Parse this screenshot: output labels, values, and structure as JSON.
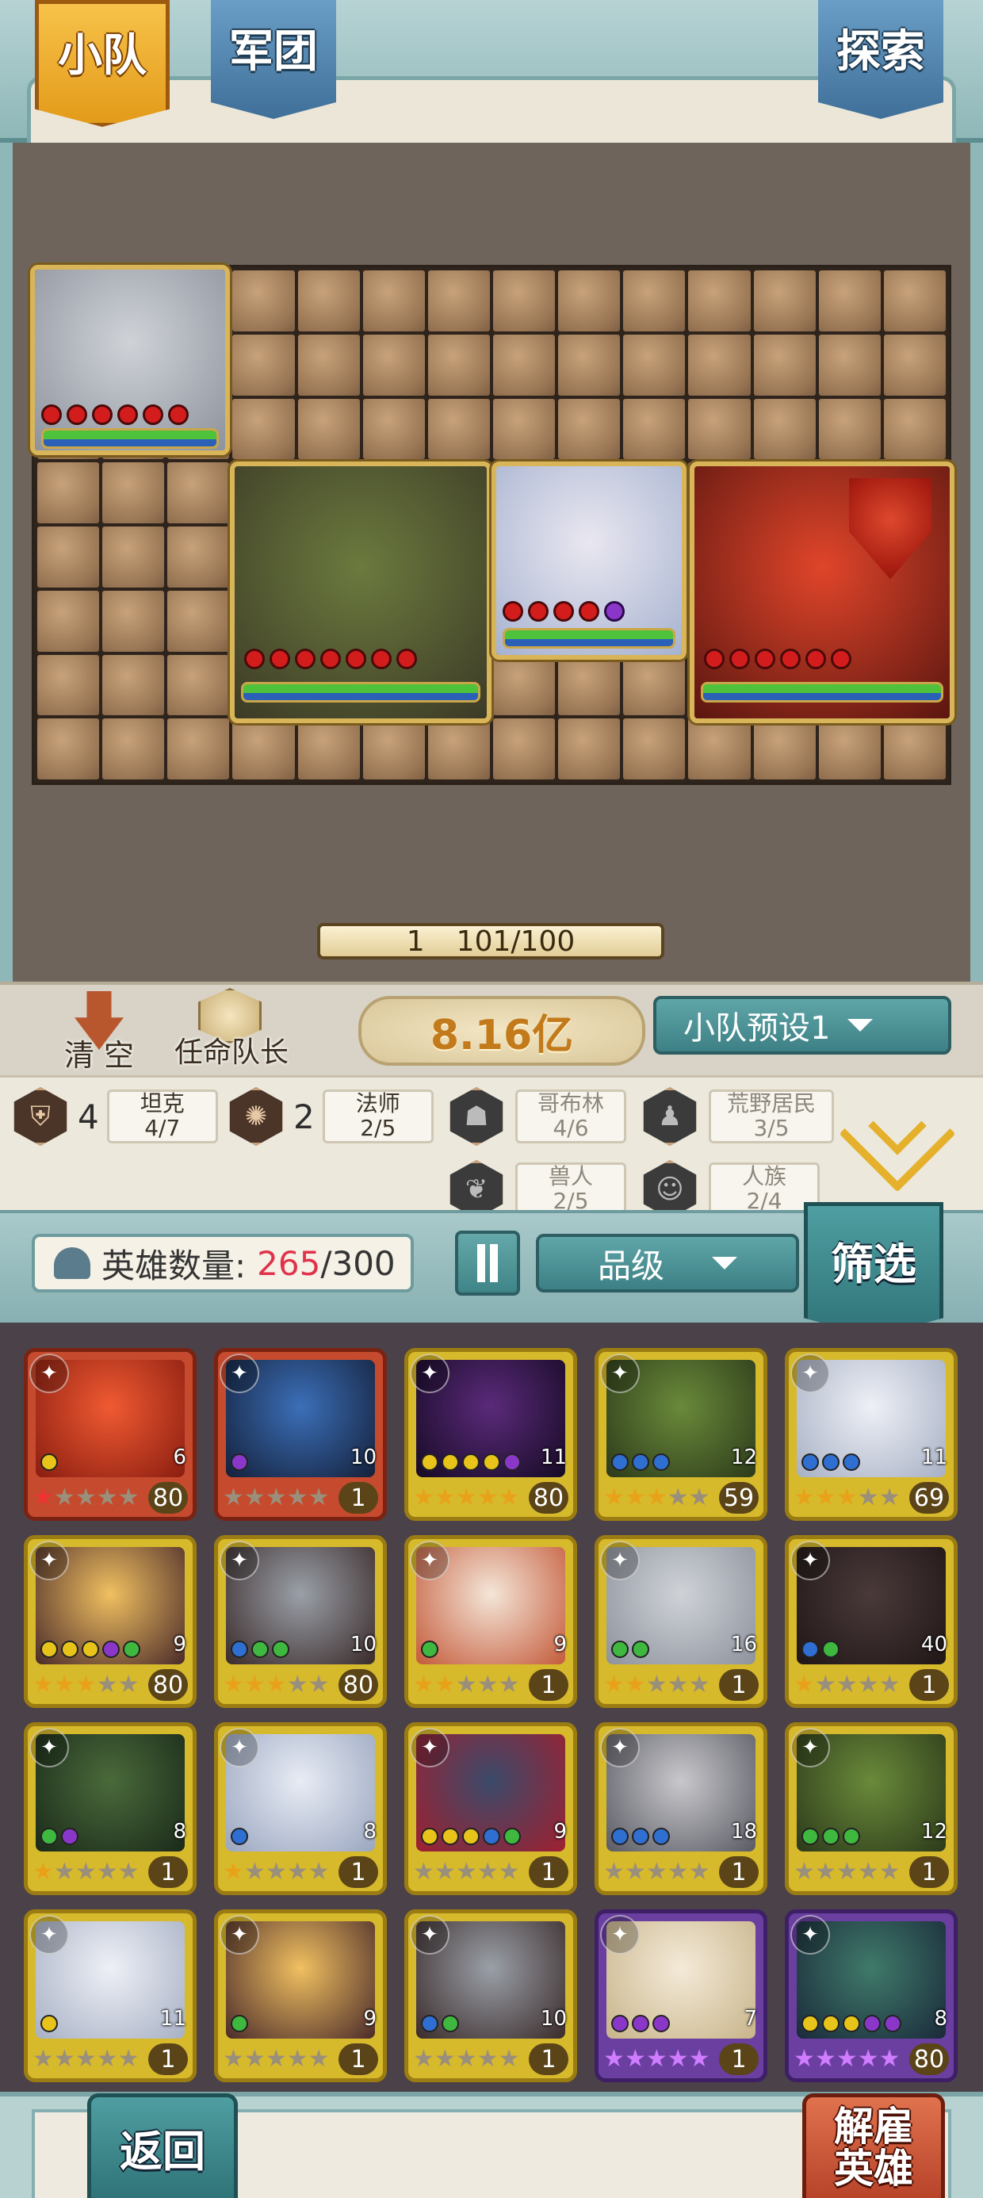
{
  "tabs": {
    "squad": "小队",
    "legion": "军团",
    "explore": "探索"
  },
  "board": {
    "level_bar": {
      "level": "1",
      "progress": "101/100"
    },
    "units": [
      {
        "name": "snow-beast",
        "dots": [
          "red",
          "red",
          "red",
          "red",
          "red",
          "red"
        ],
        "colors": [
          "#cfd3d8",
          "#8d929c"
        ]
      },
      {
        "name": "steam-golem",
        "dots": [
          "red",
          "red",
          "red",
          "red",
          "red",
          "red",
          "red"
        ],
        "colors": [
          "#6b7a3e",
          "#3c3a26"
        ]
      },
      {
        "name": "silver-paladin",
        "dots": [
          "red",
          "red",
          "red",
          "red",
          "purple"
        ],
        "colors": [
          "#e9e7f0",
          "#a6b2d0"
        ]
      },
      {
        "name": "fire-bear",
        "dots": [
          "red",
          "red",
          "red",
          "red",
          "red",
          "red"
        ],
        "colors": [
          "#e0452a",
          "#5a1610"
        ]
      }
    ]
  },
  "controls": {
    "clear": "清 空",
    "appoint_captain": "任命队长",
    "power": "8.16亿",
    "preset": "小队预设1"
  },
  "synergy": [
    {
      "count": "4",
      "name": "坦克",
      "progress": "4/7",
      "icon": "shield-icon",
      "active": true
    },
    {
      "count": "2",
      "name": "法师",
      "progress": "2/5",
      "icon": "magic-icon",
      "active": true
    },
    {
      "count": "",
      "name": "哥布林",
      "progress": "4/6",
      "icon": "goblin-icon",
      "active": false
    },
    {
      "count": "",
      "name": "荒野居民",
      "progress": "3/5",
      "icon": "wildling-icon",
      "active": false
    },
    {
      "count": "",
      "name": "兽人",
      "progress": "2/5",
      "icon": "orc-icon",
      "active": false
    },
    {
      "count": "",
      "name": "人族",
      "progress": "2/4",
      "icon": "human-icon",
      "active": false
    }
  ],
  "roster": {
    "label": "英雄数量:",
    "current": "265",
    "max": "/300",
    "sort_label": "品级",
    "filter": "筛选"
  },
  "heroes": [
    {
      "tier": "red",
      "level": "80",
      "cost": "6",
      "stars": 1,
      "gems": [
        "#e8c41a"
      ],
      "colors": [
        "#f05a32",
        "#8a1d10"
      ]
    },
    {
      "tier": "red",
      "level": "1",
      "cost": "10",
      "stars": 0,
      "gems": [
        "#8a37c9"
      ],
      "colors": [
        "#3b6fb8",
        "#14203a"
      ]
    },
    {
      "tier": "gold",
      "level": "80",
      "cost": "11",
      "stars": 5,
      "gems": [
        "#e8c41a",
        "#e8c41a",
        "#e8c41a",
        "#e8c41a",
        "#8a37c9"
      ],
      "colors": [
        "#5a2a7a",
        "#160a24"
      ]
    },
    {
      "tier": "gold",
      "level": "59",
      "cost": "12",
      "stars": 3,
      "gems": [
        "#2f6fd1",
        "#2f6fd1",
        "#2f6fd1"
      ],
      "colors": [
        "#6a8a3a",
        "#2c3a1a"
      ]
    },
    {
      "tier": "gold",
      "level": "69",
      "cost": "11",
      "stars": 3,
      "gems": [
        "#2f6fd1",
        "#2f6fd1",
        "#2f6fd1"
      ],
      "colors": [
        "#eef0f6",
        "#a7b0c4"
      ]
    },
    {
      "tier": "gold",
      "level": "80",
      "cost": "9",
      "stars": 3,
      "gems": [
        "#e8c41a",
        "#e8c41a",
        "#e8c41a",
        "#8a37c9",
        "#3fb83f"
      ],
      "colors": [
        "#f0c060",
        "#4a2a2a"
      ]
    },
    {
      "tier": "gold",
      "level": "80",
      "cost": "10",
      "stars": 3,
      "gems": [
        "#2f6fd1",
        "#3fb83f",
        "#3fb83f"
      ],
      "colors": [
        "#9aa0a8",
        "#3a2a2a"
      ]
    },
    {
      "tier": "gold",
      "level": "1",
      "cost": "9",
      "stars": 2,
      "gems": [
        "#3fb83f"
      ],
      "colors": [
        "#f4e6d8",
        "#c45a3a"
      ]
    },
    {
      "tier": "gold",
      "level": "1",
      "cost": "16",
      "stars": 2,
      "gems": [
        "#3fb83f",
        "#3fb83f"
      ],
      "colors": [
        "#cfd3d8",
        "#8d929c"
      ]
    },
    {
      "tier": "gold",
      "level": "1",
      "cost": "40",
      "stars": 1,
      "gems": [
        "#2f6fd1",
        "#3fb83f"
      ],
      "colors": [
        "#4a3a3a",
        "#201616"
      ]
    },
    {
      "tier": "gold",
      "level": "1",
      "cost": "8",
      "stars": 1,
      "gems": [
        "#3fb83f",
        "#8a37c9"
      ],
      "colors": [
        "#4a6a3a",
        "#1a2a1a"
      ]
    },
    {
      "tier": "gold",
      "level": "1",
      "cost": "8",
      "stars": 1,
      "gems": [
        "#2f6fd1"
      ],
      "colors": [
        "#e8ecf4",
        "#9aa6c0"
      ]
    },
    {
      "tier": "gold",
      "level": "1",
      "cost": "9",
      "stars": 0,
      "gems": [
        "#e8c41a",
        "#e8c41a",
        "#e8c41a",
        "#2f6fd1",
        "#3fb83f"
      ],
      "colors": [
        "#3a4a6a",
        "#a02030"
      ]
    },
    {
      "tier": "gold",
      "level": "1",
      "cost": "18",
      "stars": 0,
      "gems": [
        "#2f6fd1",
        "#2f6fd1",
        "#2f6fd1"
      ],
      "colors": [
        "#c8c8cc",
        "#5a5a64"
      ]
    },
    {
      "tier": "gold",
      "level": "1",
      "cost": "12",
      "stars": 0,
      "gems": [
        "#3fb83f",
        "#3fb83f",
        "#3fb83f"
      ],
      "colors": [
        "#6a8a3a",
        "#2c3a1a"
      ]
    },
    {
      "tier": "gold",
      "level": "1",
      "cost": "11",
      "stars": 0,
      "gems": [
        "#e8c41a"
      ],
      "colors": [
        "#eef0f6",
        "#a7b0c4"
      ]
    },
    {
      "tier": "gold",
      "level": "1",
      "cost": "9",
      "stars": 0,
      "gems": [
        "#3fb83f"
      ],
      "colors": [
        "#f0c060",
        "#4a2a2a"
      ]
    },
    {
      "tier": "gold",
      "level": "1",
      "cost": "10",
      "stars": 0,
      "gems": [
        "#2f6fd1",
        "#3fb83f"
      ],
      "colors": [
        "#9aa0a8",
        "#3a2a2a"
      ]
    },
    {
      "tier": "purple",
      "level": "1",
      "cost": "7",
      "stars": 5,
      "gems": [
        "#8a37c9",
        "#8a37c9",
        "#8a37c9"
      ],
      "colors": [
        "#f4ead8",
        "#c8b48a"
      ]
    },
    {
      "tier": "purple",
      "level": "80",
      "cost": "8",
      "stars": 5,
      "gems": [
        "#e8c41a",
        "#e8c41a",
        "#e8c41a",
        "#8a37c9",
        "#8a37c9"
      ],
      "colors": [
        "#3f7a6a",
        "#1a2a3a"
      ]
    }
  ],
  "bottom": {
    "back": "返回",
    "dismiss_line1": "解雇",
    "dismiss_line2": "英雄"
  }
}
